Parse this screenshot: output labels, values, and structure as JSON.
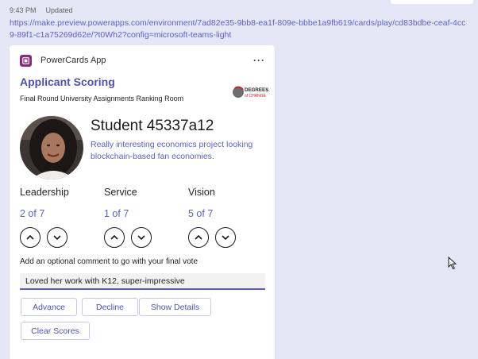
{
  "meta": {
    "time": "9:43 PM",
    "status": "Updated"
  },
  "url": "https://make.preview.powerapps.com/environment/7ad82e35-9bb8-ea1f-809e-bbbe1a9fb619/cards/play/cd83bdbe-ceaf-4cc9-89f1-c1a75269d62e/?t0Wh2?config=microsoft-teams-light",
  "card": {
    "app_name": "PowerCards App",
    "more_icon": "more-horizontal-icon",
    "title": "Applicant Scoring",
    "subtitle": "Final Round University Assignments Ranking Room",
    "logo": {
      "line1": "DEGREES",
      "line2": "of CHANGE"
    },
    "student_name": "Student 45337a12",
    "student_desc": "Really interesting economics project looking blockchain-based fan economies.",
    "categories": [
      {
        "label": "Leadership",
        "value": "2 of 7"
      },
      {
        "label": "Service",
        "value": "1 of 7"
      },
      {
        "label": "Vision",
        "value": "5 of 7"
      }
    ],
    "comment_label": "Add an optional comment to go with your final vote",
    "comment_value": "Loved her work with K12, super-impressive",
    "buttons": {
      "advance": "Advance",
      "decline": "Decline",
      "show_details": "Show Details",
      "clear_scores": "Clear Scores"
    }
  },
  "colors": {
    "accent": "#5b5fc7",
    "title": "#4f52b2",
    "background": "#e6e7f6",
    "app_icon": "#8b2a7c"
  }
}
